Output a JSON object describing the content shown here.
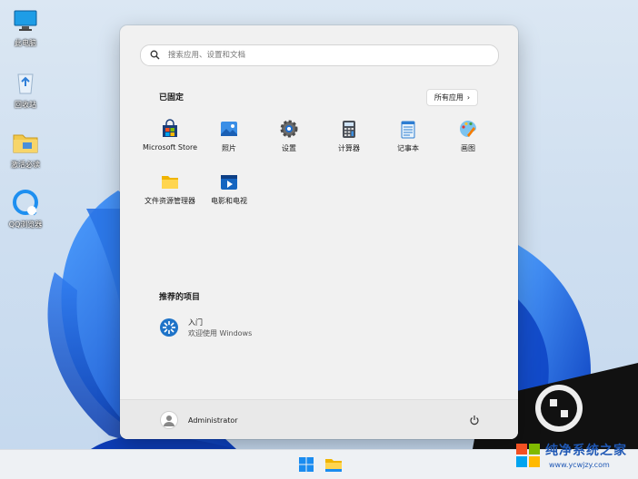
{
  "desktop": {
    "icons": [
      {
        "label": "此电脑",
        "icon": "computer-icon"
      },
      {
        "label": "回收站",
        "icon": "recycle-bin-icon"
      },
      {
        "label": "激活必读",
        "icon": "folder-icon"
      },
      {
        "label": "QQ浏览器",
        "icon": "qq-browser-icon"
      }
    ]
  },
  "start_menu": {
    "search_placeholder": "搜索应用、设置和文档",
    "pinned_title": "已固定",
    "all_apps_label": "所有应用",
    "pinned_apps": [
      {
        "label": "Microsoft Store",
        "icon": "store-icon"
      },
      {
        "label": "照片",
        "icon": "photos-icon"
      },
      {
        "label": "设置",
        "icon": "settings-gear-icon"
      },
      {
        "label": "计算器",
        "icon": "calculator-icon"
      },
      {
        "label": "记事本",
        "icon": "notepad-icon"
      },
      {
        "label": "画图",
        "icon": "paint-icon"
      },
      {
        "label": "文件资源管理器",
        "icon": "file-explorer-icon"
      },
      {
        "label": "电影和电视",
        "icon": "movies-tv-icon"
      }
    ],
    "recommended_title": "推荐的项目",
    "recommended": [
      {
        "title": "入门",
        "subtitle": "欢迎使用 Windows",
        "icon": "get-started-icon"
      }
    ],
    "user_name": "Administrator"
  },
  "taskbar": {
    "items": [
      {
        "name": "start",
        "icon": "windows-start-icon"
      },
      {
        "name": "explorer",
        "icon": "file-explorer-icon"
      }
    ]
  },
  "watermark": {
    "text": "纯净系统之家",
    "url": "www.ycwjzy.com"
  },
  "colors": {
    "accent": "#0067c0",
    "wallpaper_blue": "#1a5fd6"
  }
}
